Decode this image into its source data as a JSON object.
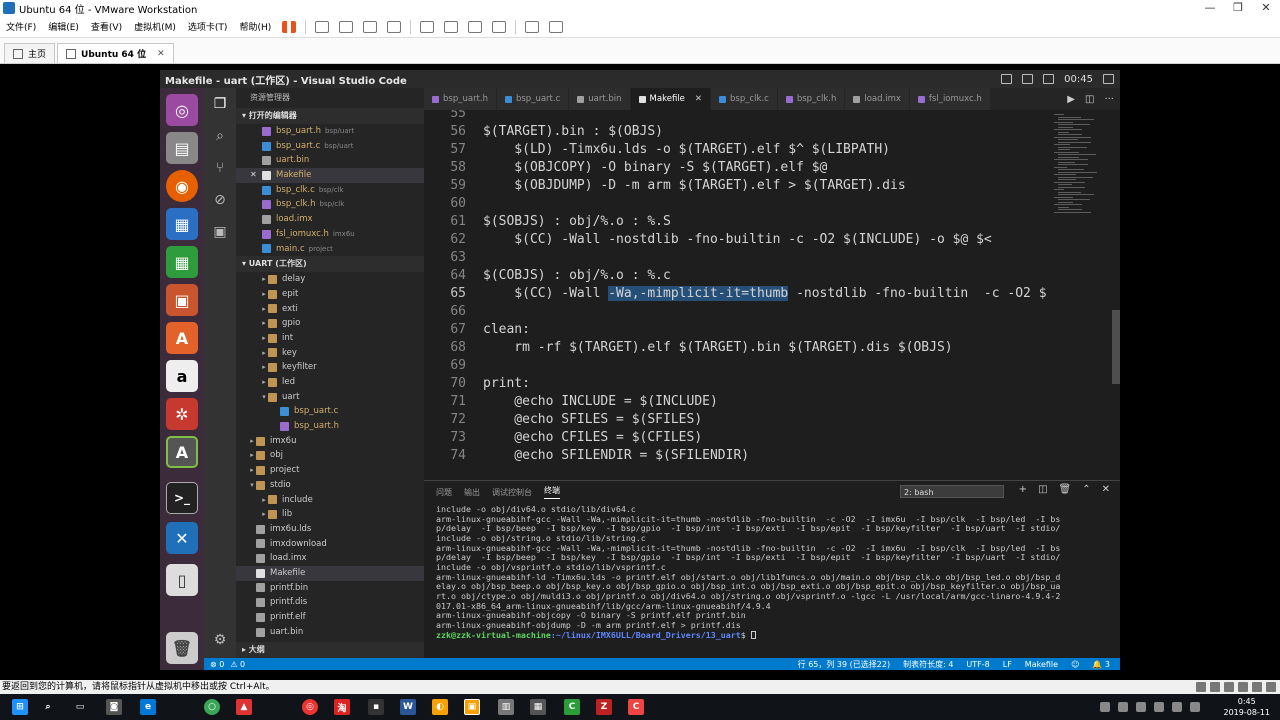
{
  "vmware": {
    "title": "Ubuntu 64 位 - VMware Workstation",
    "window_controls": [
      "—",
      "❐",
      "✕"
    ],
    "menus": [
      "文件(F)",
      "编辑(E)",
      "查看(V)",
      "虚拟机(M)",
      "选项卡(T)",
      "帮助(H)"
    ],
    "tabs": [
      {
        "label": "主页"
      },
      {
        "label": "Ubuntu 64 位",
        "close": "✕"
      }
    ],
    "status_text": "要返回到您的计算机，请将鼠标指针从虚拟机中移出或按 Ctrl+Alt。"
  },
  "vscode": {
    "title": "Makefile - uart (工作区) - Visual Studio Code",
    "clock": "00:45",
    "sidebar": {
      "title": "资源管理器",
      "open_editors_section": "▾ 打开的编辑器",
      "open_editors": [
        {
          "name": "bsp_uart.h",
          "desc": "bsp/uart",
          "type": "h"
        },
        {
          "name": "bsp_uart.c",
          "desc": "bsp/uart",
          "type": "c"
        },
        {
          "name": "uart.bin",
          "desc": "",
          "type": "bin"
        },
        {
          "name": "Makefile",
          "desc": "",
          "type": "mk",
          "selected": true,
          "close": "✕"
        },
        {
          "name": "bsp_clk.c",
          "desc": "bsp/clk",
          "type": "c"
        },
        {
          "name": "bsp_clk.h",
          "desc": "bsp/clk",
          "type": "h"
        },
        {
          "name": "load.imx",
          "desc": "",
          "type": "bin"
        },
        {
          "name": "fsl_iomuxc.h",
          "desc": "imx6u",
          "type": "h"
        },
        {
          "name": "main.c",
          "desc": "project",
          "type": "c"
        }
      ],
      "workspace_section": "▾ UART (工作区)",
      "tree": [
        {
          "name": "delay",
          "depth": 1,
          "folder": true,
          "open": false
        },
        {
          "name": "epit",
          "depth": 1,
          "folder": true,
          "open": false
        },
        {
          "name": "exti",
          "depth": 1,
          "folder": true,
          "open": false
        },
        {
          "name": "gpio",
          "depth": 1,
          "folder": true,
          "open": false
        },
        {
          "name": "int",
          "depth": 1,
          "folder": true,
          "open": false
        },
        {
          "name": "key",
          "depth": 1,
          "folder": true,
          "open": false
        },
        {
          "name": "keyfilter",
          "depth": 1,
          "folder": true,
          "open": false
        },
        {
          "name": "led",
          "depth": 1,
          "folder": true,
          "open": false
        },
        {
          "name": "uart",
          "depth": 1,
          "folder": true,
          "open": true
        },
        {
          "name": "bsp_uart.c",
          "depth": 2,
          "type": "c"
        },
        {
          "name": "bsp_uart.h",
          "depth": 2,
          "type": "h"
        },
        {
          "name": "imx6u",
          "depth": 0,
          "folder": true,
          "open": false
        },
        {
          "name": "obj",
          "depth": 0,
          "folder": true,
          "open": false
        },
        {
          "name": "project",
          "depth": 0,
          "folder": true,
          "open": false
        },
        {
          "name": "stdio",
          "depth": 0,
          "folder": true,
          "open": true
        },
        {
          "name": "include",
          "depth": 1,
          "folder": true,
          "open": false
        },
        {
          "name": "lib",
          "depth": 1,
          "folder": true,
          "open": false
        },
        {
          "name": "imx6u.lds",
          "depth": 0,
          "type": "bin"
        },
        {
          "name": "imxdownload",
          "depth": 0,
          "type": "bin"
        },
        {
          "name": "load.imx",
          "depth": 0,
          "type": "bin"
        },
        {
          "name": "Makefile",
          "depth": 0,
          "type": "mk",
          "selected": true
        },
        {
          "name": "printf.bin",
          "depth": 0,
          "type": "bin"
        },
        {
          "name": "printf.dis",
          "depth": 0,
          "type": "bin"
        },
        {
          "name": "printf.elf",
          "depth": 0,
          "type": "bin"
        },
        {
          "name": "uart.bin",
          "depth": 0,
          "type": "bin"
        }
      ],
      "outline_section": "▸ 大纲"
    },
    "tabs": [
      {
        "label": "bsp_uart.h",
        "type": "h"
      },
      {
        "label": "bsp_uart.c",
        "type": "c"
      },
      {
        "label": "uart.bin",
        "type": "bin"
      },
      {
        "label": "Makefile",
        "type": "mk",
        "active": true,
        "close": "✕"
      },
      {
        "label": "bsp_clk.c",
        "type": "c"
      },
      {
        "label": "bsp_clk.h",
        "type": "h"
      },
      {
        "label": "load.imx",
        "type": "bin"
      },
      {
        "label": "fsl_iomuxc.h",
        "type": "h"
      }
    ],
    "editor": {
      "current_line": 65,
      "lines": [
        {
          "n": 55,
          "text": ""
        },
        {
          "n": 56,
          "text": "$(TARGET).bin : $(OBJS)"
        },
        {
          "n": 57,
          "text": "    $(LD) -Timx6u.lds -o $(TARGET).elf $^ $(LIBPATH)"
        },
        {
          "n": 58,
          "text": "    $(OBJCOPY) -O binary -S $(TARGET).elf $@"
        },
        {
          "n": 59,
          "text": "    $(OBJDUMP) -D -m arm $(TARGET).elf > $(TARGET).dis"
        },
        {
          "n": 60,
          "text": ""
        },
        {
          "n": 61,
          "text": "$(SOBJS) : obj/%.o : %.S"
        },
        {
          "n": 62,
          "text": "    $(CC) -Wall -nostdlib -fno-builtin -c -O2 $(INCLUDE) -o $@ $<"
        },
        {
          "n": 63,
          "text": ""
        },
        {
          "n": 64,
          "text": "$(COBJS) : obj/%.o : %.c"
        },
        {
          "n": 65,
          "text": "    $(CC) -Wall ",
          "sel": "-Wa,-mimplicit-it=thumb",
          "after": " -nostdlib -fno-builtin  -c -O2 $"
        },
        {
          "n": 66,
          "text": ""
        },
        {
          "n": 67,
          "text": "clean:"
        },
        {
          "n": 68,
          "text": "    rm -rf $(TARGET).elf $(TARGET).bin $(TARGET).dis $(OBJS)"
        },
        {
          "n": 69,
          "text": ""
        },
        {
          "n": 70,
          "text": "print:"
        },
        {
          "n": 71,
          "text": "    @echo INCLUDE = $(INCLUDE)"
        },
        {
          "n": 72,
          "text": "    @echo SFILES = $(SFILES)"
        },
        {
          "n": 73,
          "text": "    @echo CFILES = $(CFILES)"
        },
        {
          "n": 74,
          "text": "    @echo SFILENDIR = $(SFILENDIR)"
        }
      ]
    },
    "panel": {
      "tabs": [
        "问题",
        "输出",
        "调试控制台",
        "终端"
      ],
      "active_tab": "终端",
      "terminal_select": "2: bash",
      "terminal_lines": [
        "include -o obj/div64.o stdio/lib/div64.c",
        "arm-linux-gnueabihf-gcc -Wall -Wa,-mimplicit-it=thumb -nostdlib -fno-builtin  -c -O2  -I imx6u  -I bsp/clk  -I bsp/led  -I bs",
        "p/delay  -I bsp/beep  -I bsp/key  -I bsp/gpio  -I bsp/int  -I bsp/exti  -I bsp/epit  -I bsp/keyfilter  -I bsp/uart  -I stdio/",
        "include -o obj/string.o stdio/lib/string.c",
        "arm-linux-gnueabihf-gcc -Wall -Wa,-mimplicit-it=thumb -nostdlib -fno-builtin  -c -O2  -I imx6u  -I bsp/clk  -I bsp/led  -I bs",
        "p/delay  -I bsp/beep  -I bsp/key  -I bsp/gpio  -I bsp/int  -I bsp/exti  -I bsp/epit  -I bsp/keyfilter  -I bsp/uart  -I stdio/",
        "include -o obj/vsprintf.o stdio/lib/vsprintf.c",
        "arm-linux-gnueabihf-ld -Timx6u.lds -o printf.elf obj/start.o obj/lib1funcs.o obj/main.o obj/bsp_clk.o obj/bsp_led.o obj/bsp_d",
        "elay.o obj/bsp_beep.o obj/bsp_key.o obj/bsp_gpio.o obj/bsp_int.o obj/bsp_exti.o obj/bsp_epit.o obj/bsp_keyfilter.o obj/bsp_ua",
        "rt.o obj/ctype.o obj/muldi3.o obj/printf.o obj/div64.o obj/string.o obj/vsprintf.o -lgcc -L /usr/local/arm/gcc-linaro-4.9.4-2",
        "017.01-x86_64_arm-linux-gnueabihf/lib/gcc/arm-linux-gnueabihf/4.9.4",
        "arm-linux-gnueabihf-objcopy -O binary -S printf.elf printf.bin",
        "arm-linux-gnueabihf-objdump -D -m arm printf.elf > printf.dis"
      ],
      "prompt_user": "zzk@zzk-virtual-machine",
      "prompt_path": ":~/linux/IMX6ULL/Board_Drivers/13_uart",
      "prompt_symbol": "$ "
    },
    "statusbar": {
      "errors": "⊗ 0",
      "warnings": "⚠ 0",
      "position": "行 65，列 39 (已选择22)",
      "tab_size": "制表符长度: 4",
      "encoding": "UTF-8",
      "eol": "LF",
      "language": "Makefile",
      "notifications": "🔔 3"
    }
  },
  "taskbar": {
    "time": "0:45",
    "date": "2019-08-11"
  }
}
